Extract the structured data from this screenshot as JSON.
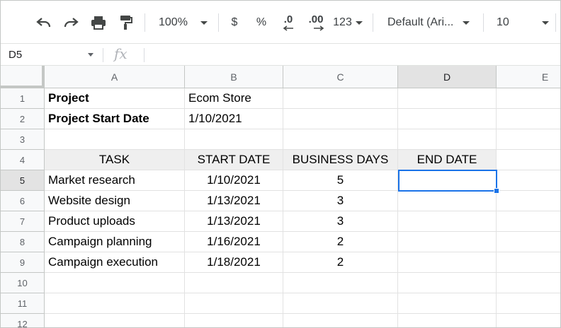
{
  "toolbar": {
    "zoom": "100%",
    "currency": "$",
    "percent": "%",
    "decrease_decimal": ".0",
    "increase_decimal": ".00",
    "more_formats": "123",
    "font": "Default (Ari...",
    "font_size": "10"
  },
  "formula_bar": {
    "cell_ref": "D5",
    "fx_label": "fx",
    "value": ""
  },
  "columns": [
    "A",
    "B",
    "C",
    "D",
    "E"
  ],
  "rows": [
    "1",
    "2",
    "3",
    "4",
    "5",
    "6",
    "7",
    "8",
    "9",
    "10",
    "11",
    "12"
  ],
  "sheet": {
    "project_label": "Project",
    "project_value": "Ecom Store",
    "start_label": "Project Start Date",
    "start_value": "1/10/2021",
    "headers": [
      "TASK",
      "START DATE",
      "BUSINESS DAYS",
      "END DATE"
    ],
    "tasks": [
      {
        "task": "Market research",
        "start": "1/10/2021",
        "days": "5",
        "end": ""
      },
      {
        "task": "Website design",
        "start": "1/13/2021",
        "days": "3",
        "end": ""
      },
      {
        "task": "Product uploads",
        "start": "1/13/2021",
        "days": "3",
        "end": ""
      },
      {
        "task": "Campaign planning",
        "start": "1/16/2021",
        "days": "2",
        "end": ""
      },
      {
        "task": "Campaign execution",
        "start": "1/18/2021",
        "days": "2",
        "end": ""
      }
    ]
  },
  "selection": {
    "cell": "D5",
    "column": "D",
    "row": "5"
  },
  "colors": {
    "selection": "#1a73e8",
    "header_fill": "#efefef"
  }
}
